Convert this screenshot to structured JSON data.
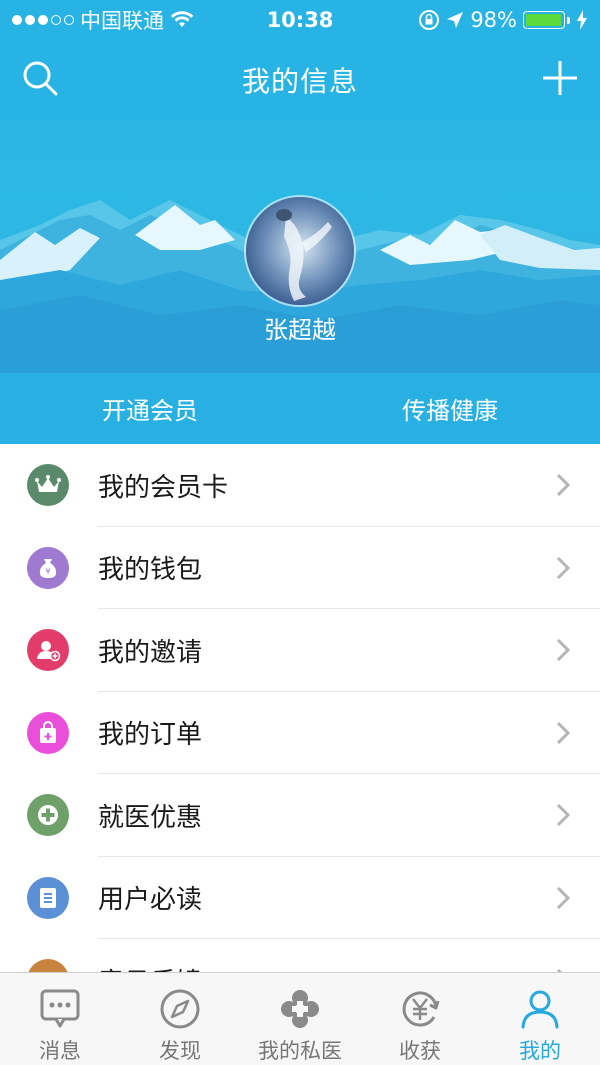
{
  "status_bar": {
    "carrier": "中国联通",
    "time": "10:38",
    "battery": "98%",
    "battery_level": 0.98
  },
  "nav": {
    "title": "我的信息",
    "search_icon": "search-icon",
    "add_icon": "plus-icon"
  },
  "profile": {
    "name": "张超越"
  },
  "actions": {
    "left": "开通会员",
    "right": "传播健康"
  },
  "menu": {
    "items": [
      {
        "label": "我的会员卡",
        "icon": "crown-icon",
        "color": "#5a8a6a"
      },
      {
        "label": "我的钱包",
        "icon": "money-bag-icon",
        "color": "#a07ad0"
      },
      {
        "label": "我的邀请",
        "icon": "invite-user-icon",
        "color": "#e23d6a"
      },
      {
        "label": "我的订单",
        "icon": "shopping-bag-icon",
        "color": "#e94fd8"
      },
      {
        "label": "就医优惠",
        "icon": "medical-cross-icon",
        "color": "#6fa06a"
      },
      {
        "label": "用户必读",
        "icon": "document-icon",
        "color": "#5b8fd6"
      },
      {
        "label": "意见反馈",
        "icon": "feedback-icon",
        "color": "#c8843e"
      }
    ]
  },
  "tabs": [
    {
      "label": "消息",
      "icon": "message-icon",
      "active": false
    },
    {
      "label": "发现",
      "icon": "compass-icon",
      "active": false
    },
    {
      "label": "我的私医",
      "icon": "clover-icon",
      "active": false
    },
    {
      "label": "收获",
      "icon": "yuan-icon",
      "active": false
    },
    {
      "label": "我的",
      "icon": "person-icon",
      "active": true
    }
  ],
  "colors": {
    "primary": "#27b3e4",
    "active_tab": "#27a9e0",
    "inactive_tab": "#777777"
  }
}
